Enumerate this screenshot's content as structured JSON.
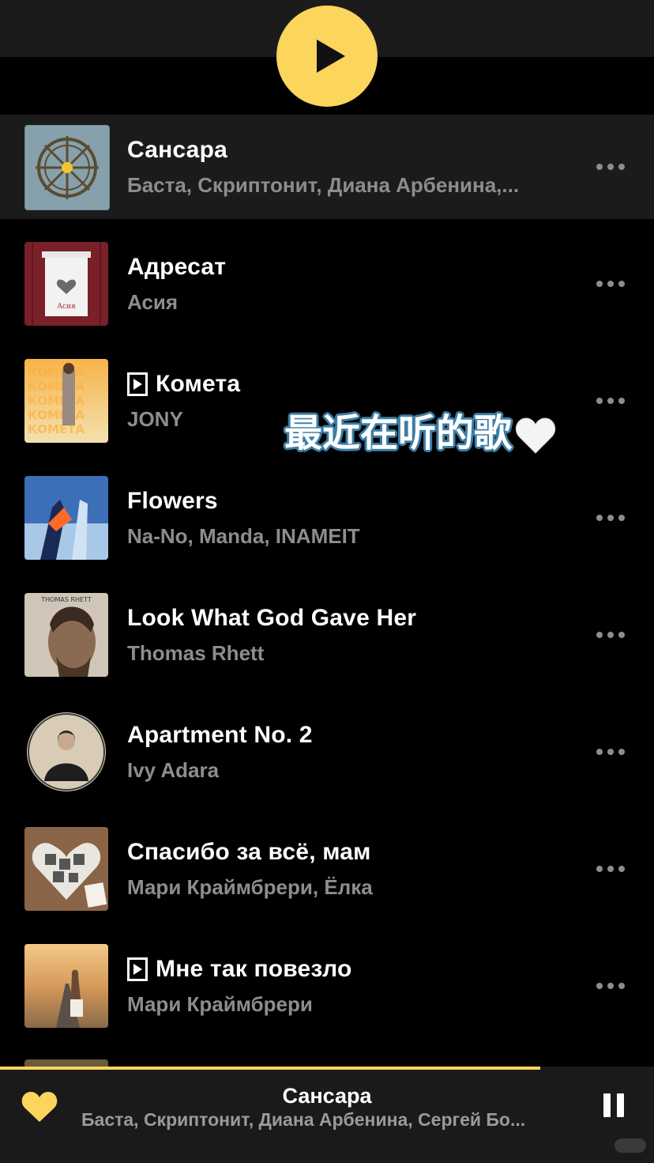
{
  "accent_color": "#fbd55c",
  "tracks": [
    {
      "title": "Сансара",
      "artist": "Баста, Скриптонит, Диана Арбенина,...",
      "video": false,
      "active": true
    },
    {
      "title": "Адресат",
      "artist": "Асия",
      "video": false,
      "active": false
    },
    {
      "title": "Комета",
      "artist": "JONY",
      "video": true,
      "active": false
    },
    {
      "title": "Flowers",
      "artist": "Na-No, Manda, INAMEIT",
      "video": false,
      "active": false
    },
    {
      "title": "Look What God Gave Her",
      "artist": "Thomas Rhett",
      "video": false,
      "active": false
    },
    {
      "title": "Apartment No. 2",
      "artist": "Ivy Adara",
      "video": false,
      "active": false
    },
    {
      "title": "Спасибо за всё, мам",
      "artist": "Мари Краймбрери, Ёлка",
      "video": false,
      "active": false
    },
    {
      "title": "Мне так повезло",
      "artist": "Мари Краймбрери",
      "video": true,
      "active": false
    }
  ],
  "overlay": {
    "text": "最近在听的歌"
  },
  "now_playing": {
    "title": "Сансара",
    "artist": "Баста, Скриптонит, Диана Арбенина, Сергей Бо...",
    "progress": 0.826
  },
  "icons": {
    "play": "play-icon",
    "more": "more-icon",
    "video": "video-icon",
    "heart": "heart-icon",
    "pause": "pause-icon"
  }
}
